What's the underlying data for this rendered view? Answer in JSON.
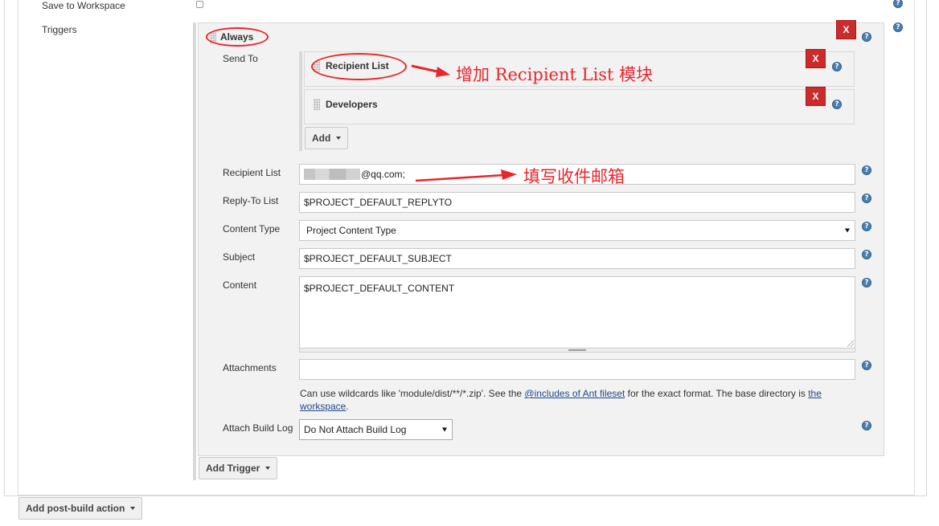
{
  "top_row": {
    "label": "Save to Workspace"
  },
  "triggers": {
    "label": "Triggers",
    "trigger": {
      "title": "Always",
      "remove_label": "X",
      "send_to": {
        "label": "Send To",
        "items": [
          {
            "title": "Recipient List",
            "remove_label": "X"
          },
          {
            "title": "Developers",
            "remove_label": "X"
          }
        ],
        "add_label": "Add"
      }
    },
    "fields": {
      "recipient_list": {
        "label": "Recipient List",
        "value": "@qq.com;"
      },
      "reply_to": {
        "label": "Reply-To List",
        "value": "$PROJECT_DEFAULT_REPLYTO"
      },
      "content_type": {
        "label": "Content Type",
        "value": "Project Content Type"
      },
      "subject": {
        "label": "Subject",
        "value": "$PROJECT_DEFAULT_SUBJECT"
      },
      "content": {
        "label": "Content",
        "value": "$PROJECT_DEFAULT_CONTENT"
      },
      "attachments": {
        "label": "Attachments",
        "value": "",
        "hint_prefix": "Can use wildcards like 'module/dist/**/*.zip'. See the ",
        "hint_link1": "@includes of Ant fileset",
        "hint_middle": " for the exact format. The base directory is ",
        "hint_link2": "the workspace",
        "hint_suffix": "."
      },
      "attach_build_log": {
        "label": "Attach Build Log",
        "value": "Do Not Attach Build Log"
      }
    },
    "add_trigger_label": "Add Trigger"
  },
  "add_post_build_label": "Add post-build action",
  "annotations": {
    "recipient_list_note": "增加 Recipient List 模块",
    "email_note": "填写收件邮箱"
  },
  "icons": {
    "help": "help-icon",
    "remove": "close-icon",
    "drag": "drag-handle-icon",
    "dropdown": "chevron-down-icon"
  },
  "colors": {
    "remove_button": "#cc2b2b",
    "annotation": "#e8262c",
    "help_icon": "#4a7fb0",
    "link": "#204a87"
  }
}
